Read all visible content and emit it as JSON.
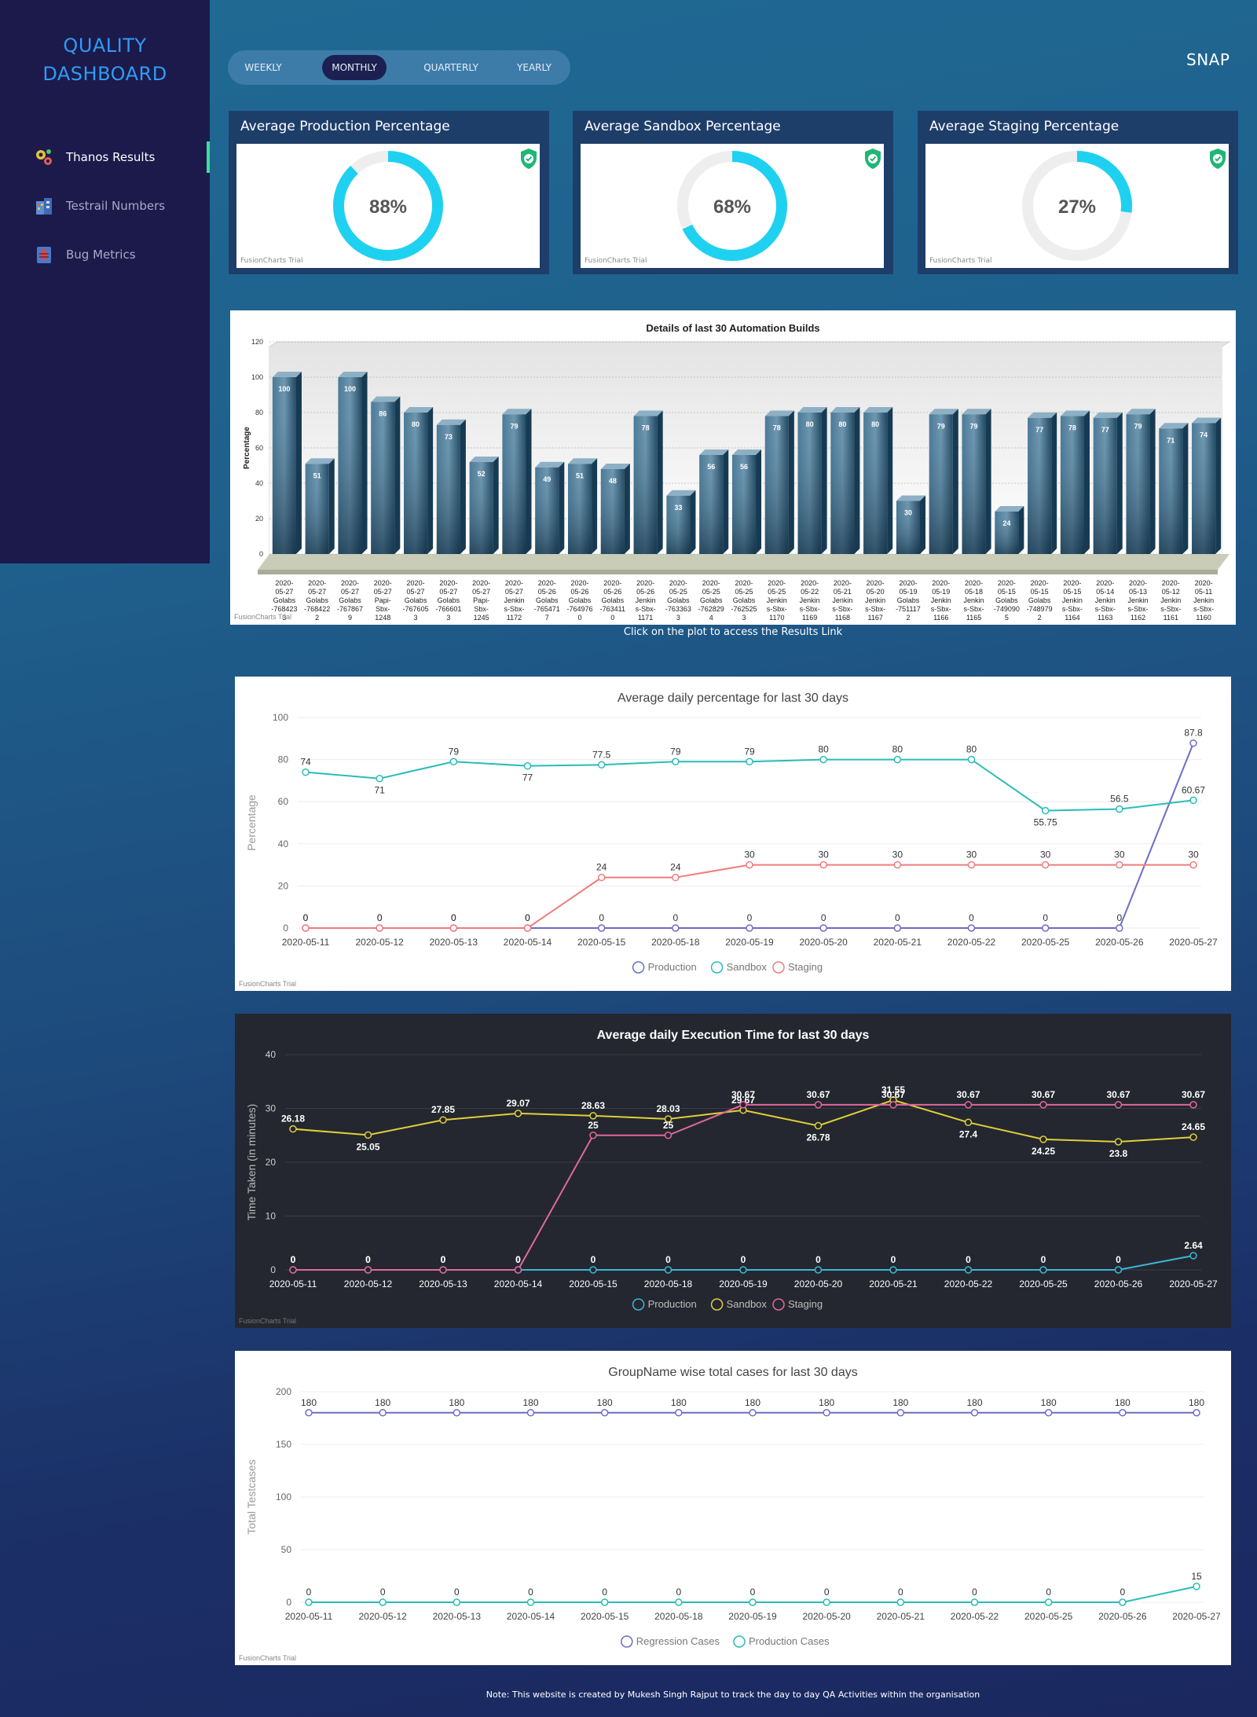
{
  "brand": {
    "line1": "QUALITY",
    "line2": "DASHBOARD"
  },
  "sidebar": {
    "items": [
      {
        "label": "Thanos Results",
        "icon": "gears-icon",
        "active": true
      },
      {
        "label": "Testrail Numbers",
        "icon": "building-icon",
        "active": false
      },
      {
        "label": "Bug Metrics",
        "icon": "bug-icon",
        "active": false
      }
    ]
  },
  "period_toggle": {
    "options": [
      "WEEKLY",
      "MONTHLY",
      "QUARTERLY",
      "YEARLY"
    ],
    "selected": "MONTHLY"
  },
  "project": "SNAP",
  "colors": {
    "cyan": "#1fd1f0",
    "bar": "#2f5f7c",
    "teal": "#2abcb8",
    "salmon": "#f07c7c",
    "indigo": "#6c6cc6",
    "yellow": "#e0cf3b",
    "pink": "#e2679f",
    "cyan_line": "#3ab7d6"
  },
  "kpis": [
    {
      "title": "Average Production Percentage",
      "value_label": "88%",
      "value": 88,
      "trial": "FusionCharts Trial",
      "icon": "shield-check-icon"
    },
    {
      "title": "Average Sandbox Percentage",
      "value_label": "68%",
      "value": 68,
      "trial": "FusionCharts Trial",
      "icon": "shield-check-icon"
    },
    {
      "title": "Average Staging Percentage",
      "value_label": "27%",
      "value": 27,
      "trial": "FusionCharts Trial",
      "icon": "shield-check-icon"
    }
  ],
  "click_note": "Click on the plot to access the Results Link",
  "footer_note": "Note: This website is created by Mukesh Singh Rajput to track the day to day QA Activities within the organisation",
  "chart_data": [
    {
      "type": "bar",
      "title": "Details of last 30 Automation Builds",
      "ylabel": "Percentage",
      "ylim": [
        0,
        120
      ],
      "yticks": [
        0,
        20,
        40,
        60,
        80,
        100,
        120
      ],
      "trial": "FusionCharts Trial",
      "categories": [
        [
          "2020-",
          "05-27",
          "Golabs",
          "-768423",
          "3"
        ],
        [
          "2020-",
          "05-27",
          "Golabs",
          "-768422",
          "2"
        ],
        [
          "2020-",
          "05-27",
          "Golabs",
          "-767867",
          "9"
        ],
        [
          "2020-",
          "05-27",
          "Papi-",
          "Sbx-",
          "1248"
        ],
        [
          "2020-",
          "05-27",
          "Golabs",
          "-767605",
          "3"
        ],
        [
          "2020-",
          "05-27",
          "Golabs",
          "-766601",
          "3"
        ],
        [
          "2020-",
          "05-27",
          "Papi-",
          "Sbx-",
          "1245"
        ],
        [
          "2020-",
          "05-27",
          "Jenkin",
          "s-Sbx-",
          "1172"
        ],
        [
          "2020-",
          "05-26",
          "Golabs",
          "-765471",
          "7"
        ],
        [
          "2020-",
          "05-26",
          "Golabs",
          "-764976",
          "0"
        ],
        [
          "2020-",
          "05-26",
          "Golabs",
          "-763411",
          "0"
        ],
        [
          "2020-",
          "05-26",
          "Jenkin",
          "s-Sbx-",
          "1171"
        ],
        [
          "2020-",
          "05-25",
          "Golabs",
          "-763363",
          "3"
        ],
        [
          "2020-",
          "05-25",
          "Golabs",
          "-762829",
          "4"
        ],
        [
          "2020-",
          "05-25",
          "Golabs",
          "-762525",
          "3"
        ],
        [
          "2020-",
          "05-25",
          "Jenkin",
          "s-Sbx-",
          "1170"
        ],
        [
          "2020-",
          "05-22",
          "Jenkin",
          "s-Sbx-",
          "1169"
        ],
        [
          "2020-",
          "05-21",
          "Jenkin",
          "s-Sbx-",
          "1168"
        ],
        [
          "2020-",
          "05-20",
          "Jenkin",
          "s-Sbx-",
          "1167"
        ],
        [
          "2020-",
          "05-19",
          "Golabs",
          "-751117",
          "2"
        ],
        [
          "2020-",
          "05-19",
          "Jenkin",
          "s-Sbx-",
          "1166"
        ],
        [
          "2020-",
          "05-18",
          "Jenkin",
          "s-Sbx-",
          "1165"
        ],
        [
          "2020-",
          "05-15",
          "Golabs",
          "-749090",
          "5"
        ],
        [
          "2020-",
          "05-15",
          "Golabs",
          "-748979",
          "2"
        ],
        [
          "2020-",
          "05-15",
          "Jenkin",
          "s-Sbx-",
          "1164"
        ],
        [
          "2020-",
          "05-14",
          "Jenkin",
          "s-Sbx-",
          "1163"
        ],
        [
          "2020-",
          "05-13",
          "Jenkin",
          "s-Sbx-",
          "1162"
        ],
        [
          "2020-",
          "05-12",
          "Jenkin",
          "s-Sbx-",
          "1161"
        ],
        [
          "2020-",
          "05-11",
          "Jenkin",
          "s-Sbx-",
          "1160"
        ]
      ],
      "values": [
        100,
        51,
        100,
        86,
        80,
        73,
        52,
        79,
        49,
        51,
        48,
        78,
        33,
        56,
        56,
        78,
        80,
        80,
        80,
        30,
        79,
        79,
        24,
        77,
        78,
        77,
        79,
        71,
        74
      ]
    },
    {
      "type": "line",
      "title": "Average daily percentage for last 30 days",
      "ylabel": "Percentage",
      "ylim": [
        0,
        100
      ],
      "yticks": [
        0,
        20,
        40,
        60,
        80,
        100
      ],
      "trial": "FusionCharts Trial",
      "x": [
        "2020-05-11",
        "2020-05-12",
        "2020-05-13",
        "2020-05-14",
        "2020-05-15",
        "2020-05-18",
        "2020-05-19",
        "2020-05-20",
        "2020-05-21",
        "2020-05-22",
        "2020-05-25",
        "2020-05-26",
        "2020-05-27"
      ],
      "series": [
        {
          "name": "Production",
          "color": "#6c6cc6",
          "values": [
            0,
            0,
            0,
            0,
            0,
            0,
            0,
            0,
            0,
            0,
            0,
            0,
            87.8
          ]
        },
        {
          "name": "Sandbox",
          "color": "#2abcb8",
          "values": [
            74,
            71,
            79,
            77,
            77.5,
            79,
            79,
            80,
            80,
            80,
            55.75,
            56.5,
            60.67
          ]
        },
        {
          "name": "Staging",
          "color": "#f07c7c",
          "values": [
            0,
            0,
            0,
            0,
            24,
            24,
            30,
            30,
            30,
            30,
            30,
            30,
            30
          ]
        }
      ]
    },
    {
      "type": "line",
      "title": "Average daily Execution Time for last 30 days",
      "ylabel": "Time Taken (in minutes)",
      "ylim": [
        0,
        40
      ],
      "yticks": [
        0,
        10,
        20,
        30,
        40
      ],
      "trial": "FusionCharts Trial",
      "dark": true,
      "x": [
        "2020-05-11",
        "2020-05-12",
        "2020-05-13",
        "2020-05-14",
        "2020-05-15",
        "2020-05-18",
        "2020-05-19",
        "2020-05-20",
        "2020-05-21",
        "2020-05-22",
        "2020-05-25",
        "2020-05-26",
        "2020-05-27"
      ],
      "series": [
        {
          "name": "Production",
          "color": "#3ab7d6",
          "values": [
            0,
            0,
            0,
            0,
            0,
            0,
            0,
            0,
            0,
            0,
            0,
            0,
            2.64
          ]
        },
        {
          "name": "Sandbox",
          "color": "#e0cf3b",
          "values": [
            26.18,
            25.05,
            27.85,
            29.07,
            28.63,
            28.03,
            29.67,
            26.78,
            31.55,
            27.4,
            24.25,
            23.8,
            24.65
          ]
        },
        {
          "name": "Staging",
          "color": "#e2679f",
          "values": [
            0,
            0,
            0,
            0,
            25,
            25,
            30.67,
            30.67,
            30.67,
            30.67,
            30.67,
            30.67,
            30.67
          ]
        }
      ]
    },
    {
      "type": "line",
      "title": "GroupName wise total cases for last 30 days",
      "ylabel": "Total Testcases",
      "ylim": [
        0,
        200
      ],
      "yticks": [
        0,
        50,
        100,
        150,
        200
      ],
      "trial": "FusionCharts Trial",
      "x": [
        "2020-05-11",
        "2020-05-12",
        "2020-05-13",
        "2020-05-14",
        "2020-05-15",
        "2020-05-18",
        "2020-05-19",
        "2020-05-20",
        "2020-05-21",
        "2020-05-22",
        "2020-05-25",
        "2020-05-26",
        "2020-05-27"
      ],
      "series": [
        {
          "name": "Regression Cases",
          "color": "#6c6cc6",
          "values": [
            180,
            180,
            180,
            180,
            180,
            180,
            180,
            180,
            180,
            180,
            180,
            180,
            180
          ]
        },
        {
          "name": "Production Cases",
          "color": "#2abcb8",
          "values": [
            0,
            0,
            0,
            0,
            0,
            0,
            0,
            0,
            0,
            0,
            0,
            0,
            15
          ]
        }
      ]
    }
  ]
}
